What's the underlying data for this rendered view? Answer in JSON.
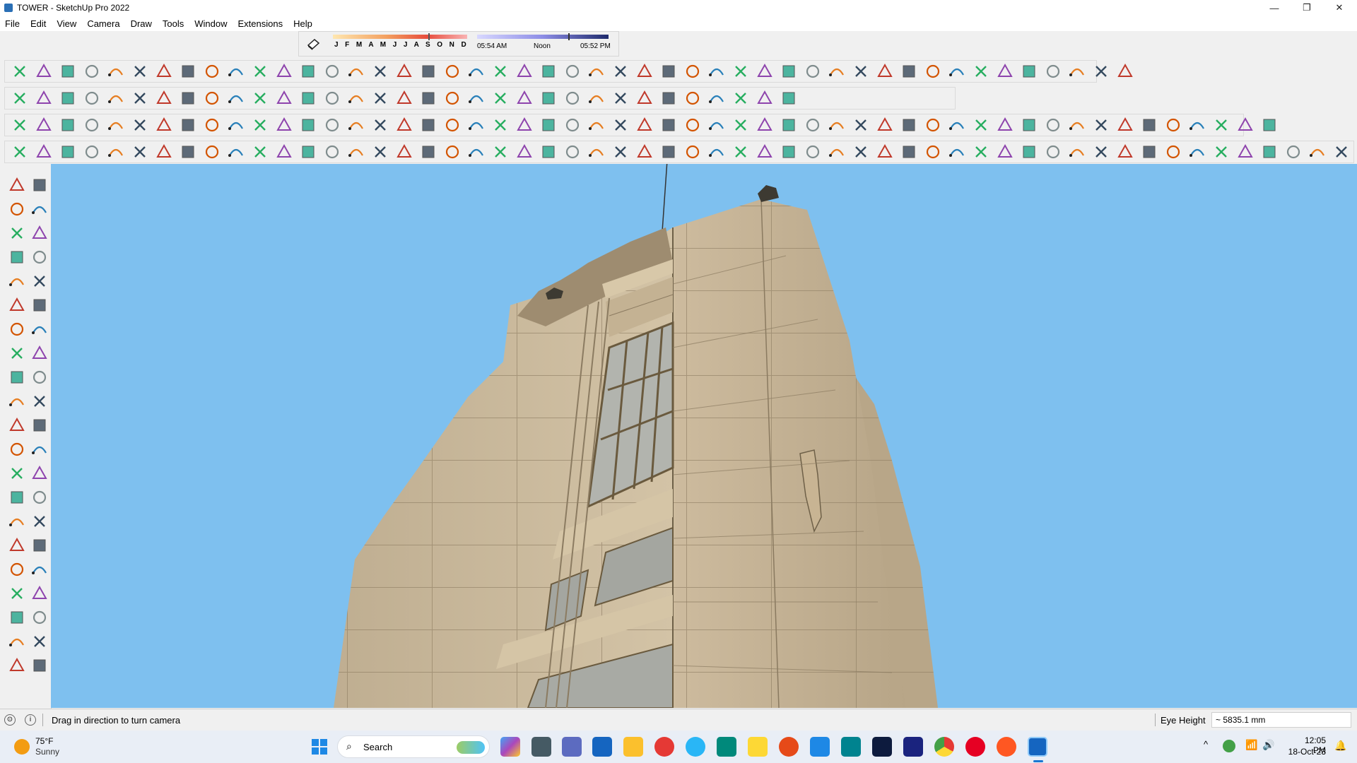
{
  "window": {
    "title": "TOWER - SketchUp Pro 2022",
    "minimize_glyph": "—",
    "maximize_glyph": "❐",
    "close_glyph": "✕"
  },
  "menu": [
    "File",
    "Edit",
    "View",
    "Camera",
    "Draw",
    "Tools",
    "Window",
    "Extensions",
    "Help"
  ],
  "shadows": {
    "months": "J F M A M J J A S O N D",
    "sunrise": "05:54 AM",
    "noon": "Noon",
    "sunset": "05:52 PM"
  },
  "toolbar_icons": {
    "row1": [
      "freehand-icon",
      "curve-icon",
      "bezier-icon",
      "knife-icon",
      "gear-shape-icon",
      "cloud-icon",
      "path-icon",
      "box-icon",
      "sphere-icon",
      "lathe-icon",
      "fillet-icon",
      "chamfer-icon",
      "extend-icon",
      "trim-icon",
      "frame-icon",
      "tent-icon",
      "column-icon",
      "spring-icon",
      "grid-icon",
      "loft-icon",
      "shell-icon",
      "divide-icon",
      "stair-icon",
      "slice-icon",
      "line-array-icon",
      "radial-array-icon",
      "weld-icon",
      "bridge-icon",
      "ribbon-icon",
      "curtain-icon",
      "wall-icon",
      "step-icon",
      "fence-icon",
      "lattice-icon",
      "louvre-icon",
      "rail-icon",
      "helix-icon",
      "twist-icon",
      "gable-icon",
      "beam-icon",
      "dome-icon",
      "plugin-house-icon",
      "door-icon",
      "home-icon",
      "garage-icon",
      "roof-icon",
      "shed-icon"
    ],
    "row2": [
      "zoom-icon",
      "select-icon",
      "eraser-icon",
      "pencil-icon",
      "shapes-icon",
      "paint-bucket-icon",
      "push-pull-icon",
      "follow-me-icon",
      "move-icon",
      "rotate-icon",
      "scale-icon",
      "tape-icon",
      "text-icon",
      "paint-icon",
      "orbit-icon",
      "pan-icon",
      "zoom-window-icon",
      "zoom-extents-icon",
      "warehouse-icon",
      "model-icon",
      "layers-icon",
      "ext-warehouse-icon",
      "user-icon",
      "sandbox-icon",
      "sandbox-up-icon",
      "sandbox-down-icon",
      "sandbox-left-icon",
      "sandbox-right-icon",
      "sandbox-front-icon",
      "sandbox-back-icon",
      "sandbox-top-icon",
      "sandbox-flip-icon",
      "style-builder-icon"
    ],
    "row3": [
      "camera-icon",
      "iso-icon",
      "top-view-icon",
      "front-view-icon",
      "right-view-icon",
      "back-view-icon",
      "left-view-icon",
      "section-icon",
      "xray-icon",
      "back-edges-icon",
      "wireframe-icon",
      "hidden-line-icon",
      "shaded-icon",
      "shaded-texture-icon",
      "monochrome-icon",
      "eraser-soft-icon",
      "tag-icon",
      "offset-icon",
      "circle-icon",
      "polygon-icon",
      "ellipse-icon",
      "rectangle-rot-icon",
      "arc-icon",
      "arc-3pt-icon",
      "pie-icon",
      "link-icon",
      "unlink-icon",
      "measure-icon",
      "tape-red-icon",
      "match-photo-icon",
      "tree-icon",
      "landscape-icon",
      "globe-icon",
      "globe2-icon",
      "teapot-icon",
      "teapot2-icon",
      "spiral-icon",
      "spiral2-icon",
      "refresh-icon",
      "layer-out-icon",
      "layer-in-icon",
      "window-icon",
      "scene-icon",
      "scene2-icon",
      "scene3-icon",
      "lock-icon",
      "roof-tile-icon",
      "brick-icon",
      "terrain-icon",
      "floor-icon",
      "wall-tex-icon",
      "carpet-icon",
      "stone-icon"
    ],
    "row4": [
      "solid-union-icon",
      "intersect-icon",
      "subtract-icon",
      "trim-solid-icon",
      "split-icon",
      "outer-shell-icon",
      "sun-icon",
      "cone-icon",
      "stars-icon",
      "hemisphere-icon",
      "sphere-wire-icon",
      "group-icon",
      "component-icon",
      "texture-grid-icon",
      "cube-wire-icon",
      "cube-tex-icon",
      "sphere-tex-icon",
      "orb-icon",
      "hand-pointer-icon",
      "blue-box-icon",
      "blue-diamond-icon",
      "gold-diamond-icon",
      "green-diamond-icon",
      "red-diamond-icon",
      "outline-diamond-icon",
      "orange-swirl-icon",
      "red-square-icon",
      "table-icon",
      "doc-icon",
      "wood-icon",
      "chain-icon",
      "curve-arrow-icon",
      "spline-icon",
      "red-cross-icon",
      "green-cross-icon",
      "blue-cross-icon",
      "cyan-cone-icon",
      "cyan-tree-icon",
      "yellow-tri-icon",
      "yellow-curve-icon",
      "yellow-twist-icon",
      "yellow-knot-icon",
      "blue-star-icon",
      "barrel-icon",
      "red-u-icon",
      "green-k-icon",
      "blue-puzzle-icon",
      "red-puzzle-icon",
      "pink-puzzle-icon",
      "red-yellow-icon",
      "pattern-icon",
      "frame-blue-icon",
      "orange-grid-icon",
      "yellow-grid-icon",
      "mesh-icon",
      "red-x-icon",
      "arc-dots-icon",
      "nodes-icon"
    ]
  },
  "left_toolbar": [
    "select-icon",
    "orbit-icon",
    "paint-bucket-icon",
    "eraser-icon",
    "make-component-icon",
    "tag-icon",
    "line-icon",
    "freehand-icon",
    "rectangle-icon",
    "rotated-rectangle-icon",
    "circle-icon",
    "polygon-icon",
    "arc-icon",
    "two-point-arc-icon",
    "three-point-arc-icon",
    "pie-icon",
    "move-icon",
    "push-pull-icon",
    "rotate-icon",
    "follow-me-icon",
    "scale-icon",
    "offset-icon",
    "tape-measure-icon",
    "dimension-icon",
    "protractor-icon",
    "text-icon",
    "axes-icon",
    "3d-text-icon",
    "orbit-tool-icon",
    "pan-icon",
    "zoom-icon",
    "zoom-window-icon",
    "zoom-extents-icon",
    "previous-icon",
    "position-camera-icon",
    "look-around-icon",
    "walk-icon",
    "section-plane-icon",
    "warehouse-icon",
    "extension-warehouse-icon",
    "layout-icon",
    "extension-manager-icon"
  ],
  "status": {
    "hint": "Drag in direction to turn camera",
    "eye_label": "Eye Height",
    "eye_value": "~ 5835.1 mm"
  },
  "taskbar": {
    "weather_temp": "75°F",
    "weather_desc": "Sunny",
    "search": "Search",
    "time": "12:05 PM",
    "date": "18-Oct-23",
    "caret": "^"
  },
  "colors": {
    "sky": "#7ec0ef",
    "stone": "#c9b79a",
    "stone_dark": "#a9977b",
    "glass": "#b5b7b1",
    "taskbar": "#e9eef6"
  }
}
